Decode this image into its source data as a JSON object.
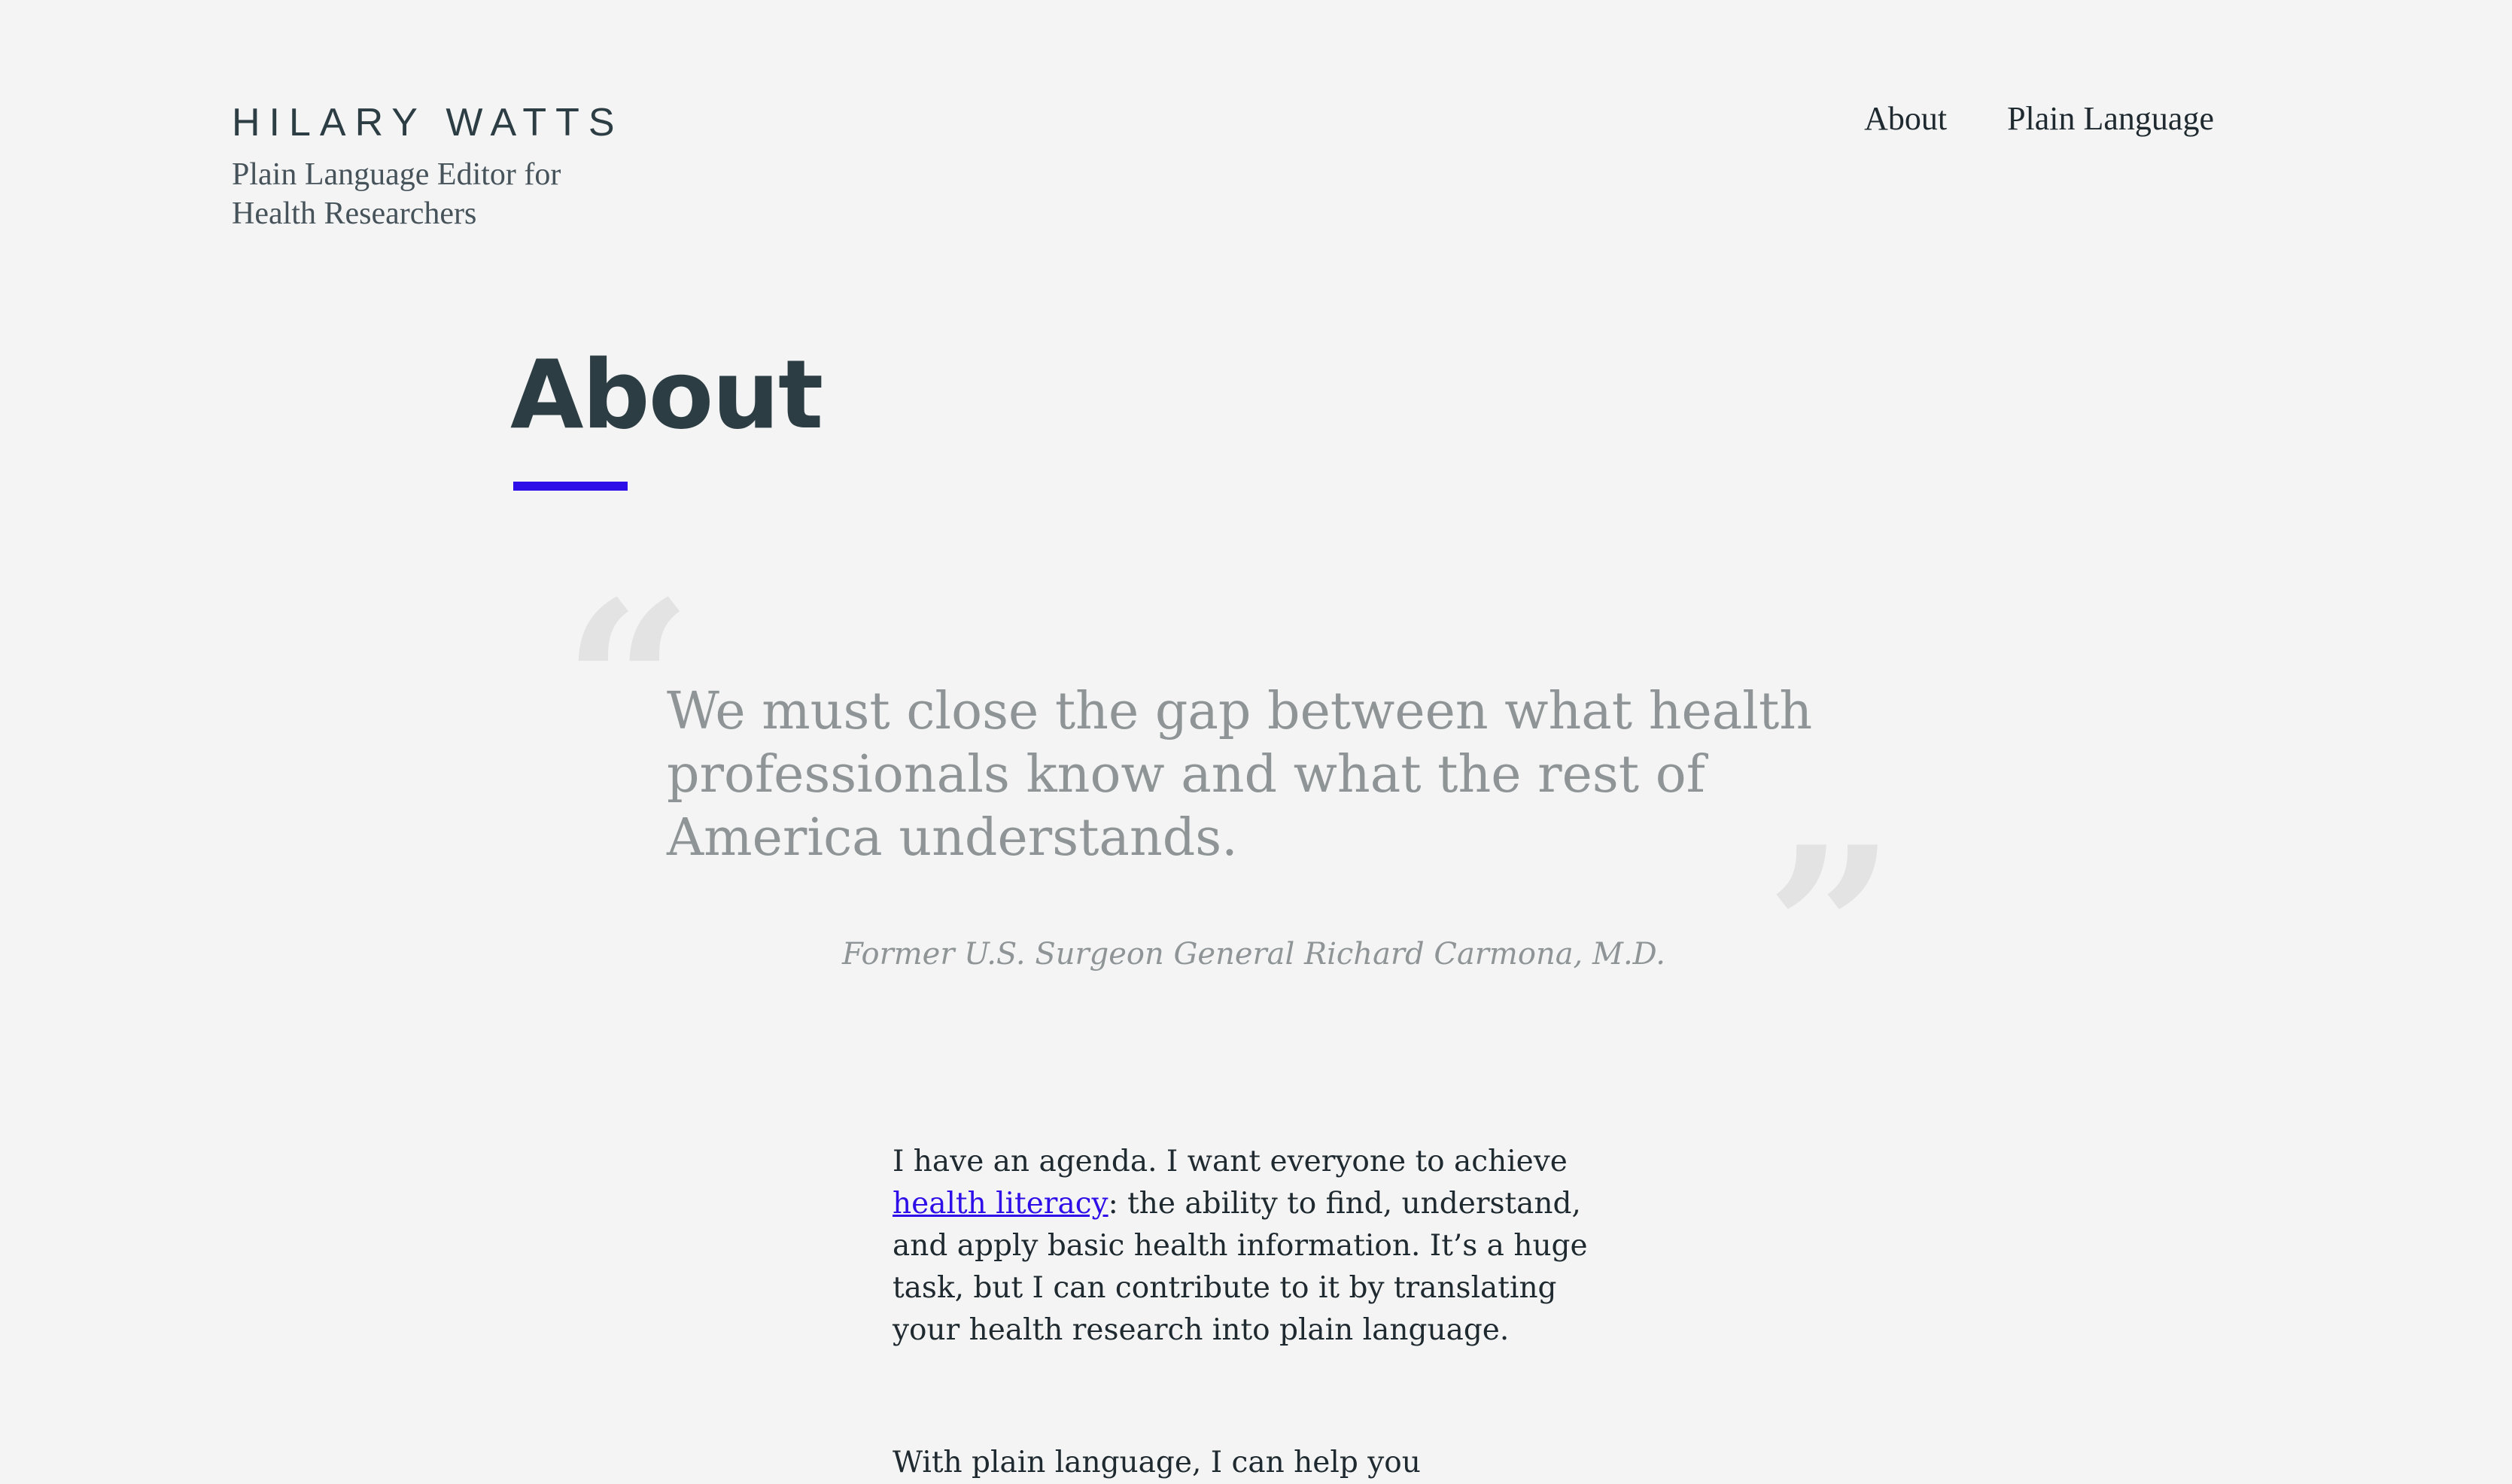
{
  "header": {
    "brand_name": "HILARY WATTS",
    "tagline": "Plain Language Editor for Health Researchers"
  },
  "nav": {
    "items": [
      {
        "label": "About"
      },
      {
        "label": "Plain Language"
      }
    ]
  },
  "main": {
    "title": "About",
    "quote": {
      "text": "We must close the gap between what health professionals know and what the rest of America understands.",
      "attribution": "Former U.S. Surgeon General Richard Carmona, M.D."
    },
    "paragraph1": {
      "before_link": "I have an agenda. I want everyone to achieve ",
      "link_text": "health literacy",
      "after_link": ": the ability to find, understand, and apply basic health information. It’s a huge task, but I can contribute to it by translating your health research into plain language."
    },
    "paragraph2": {
      "text": "With plain language, I can help you communicate"
    }
  },
  "colors": {
    "background": "#f4f4f4",
    "heading": "#2d3d44",
    "accent": "#2d0ee8",
    "quote": "#8f9597",
    "quote_mark": "#e3e3e3"
  }
}
